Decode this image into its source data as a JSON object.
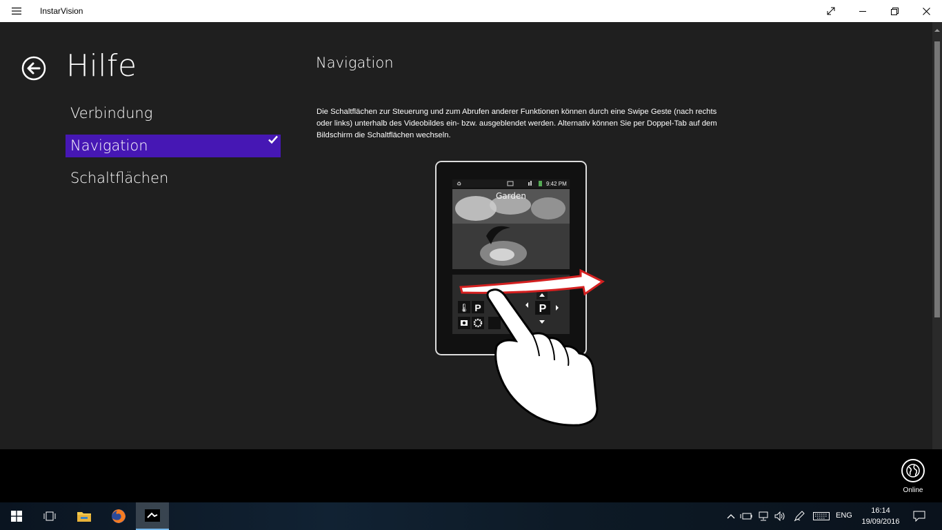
{
  "titlebar": {
    "app_title": "InstarVision"
  },
  "page": {
    "title": "Hilfe",
    "section_title": "Navigation",
    "description": "Die Schaltflächen zur Steuerung und zum Abrufen anderer Funktionen können durch eine Swipe Geste (nach rechts oder links) unterhalb des Videobildes ein- bzw. ausgeblendet werden. Alternativ können Sie per Doppel-Tab auf dem Bildschirm die Schaltflächen wechseln."
  },
  "nav": {
    "items": [
      {
        "label": "Verbindung",
        "selected": false
      },
      {
        "label": "Navigation",
        "selected": true
      },
      {
        "label": "Schaltflächen",
        "selected": false
      }
    ]
  },
  "illustration": {
    "status_time": "9:42 PM",
    "camera_label": "Garden"
  },
  "appbar": {
    "online_label": "Online"
  },
  "taskbar": {
    "language": "ENG",
    "time": "16:14",
    "date": "19/09/2016"
  },
  "colors": {
    "accent": "#4617b4",
    "app_bg": "#1f1f1f",
    "swipe_arrow": "#d42020"
  }
}
